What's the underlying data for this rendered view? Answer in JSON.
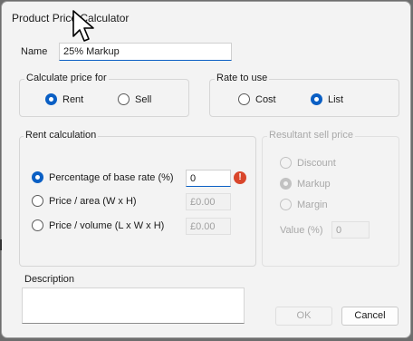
{
  "window": {
    "title": "Product Price Calculator"
  },
  "name_field": {
    "label": "Name",
    "value": "25% Markup"
  },
  "calculate_for": {
    "legend": "Calculate price for",
    "options": [
      {
        "label": "Rent",
        "selected": true
      },
      {
        "label": "Sell",
        "selected": false
      }
    ]
  },
  "rate_to_use": {
    "legend": "Rate to use",
    "options": [
      {
        "label": "Cost",
        "selected": false
      },
      {
        "label": "List",
        "selected": true
      }
    ]
  },
  "rent_calculation": {
    "legend": "Rent calculation",
    "options": [
      {
        "label": "Percentage of base rate (%)",
        "selected": true,
        "value": "0"
      },
      {
        "label": "Price / area (W x H)",
        "selected": false,
        "value": "£0.00"
      },
      {
        "label": "Price / volume (L x W x H)",
        "selected": false,
        "value": "£0.00"
      }
    ],
    "error_glyph": "!"
  },
  "resultant_sell_price": {
    "legend": "Resultant sell price",
    "enabled": false,
    "options": [
      {
        "label": "Discount",
        "selected": false
      },
      {
        "label": "Markup",
        "selected": true
      },
      {
        "label": "Margin",
        "selected": false
      }
    ],
    "value_label": "Value (%)",
    "value": "0"
  },
  "description": {
    "label": "Description",
    "value": ""
  },
  "buttons": {
    "ok": "OK",
    "cancel": "Cancel"
  },
  "icons": {
    "cursor": "mouse-pointer-icon",
    "error": "error-icon"
  },
  "colors": {
    "accent": "#0a5fc4",
    "error": "#d9462b",
    "background": "#f3f3f3"
  }
}
